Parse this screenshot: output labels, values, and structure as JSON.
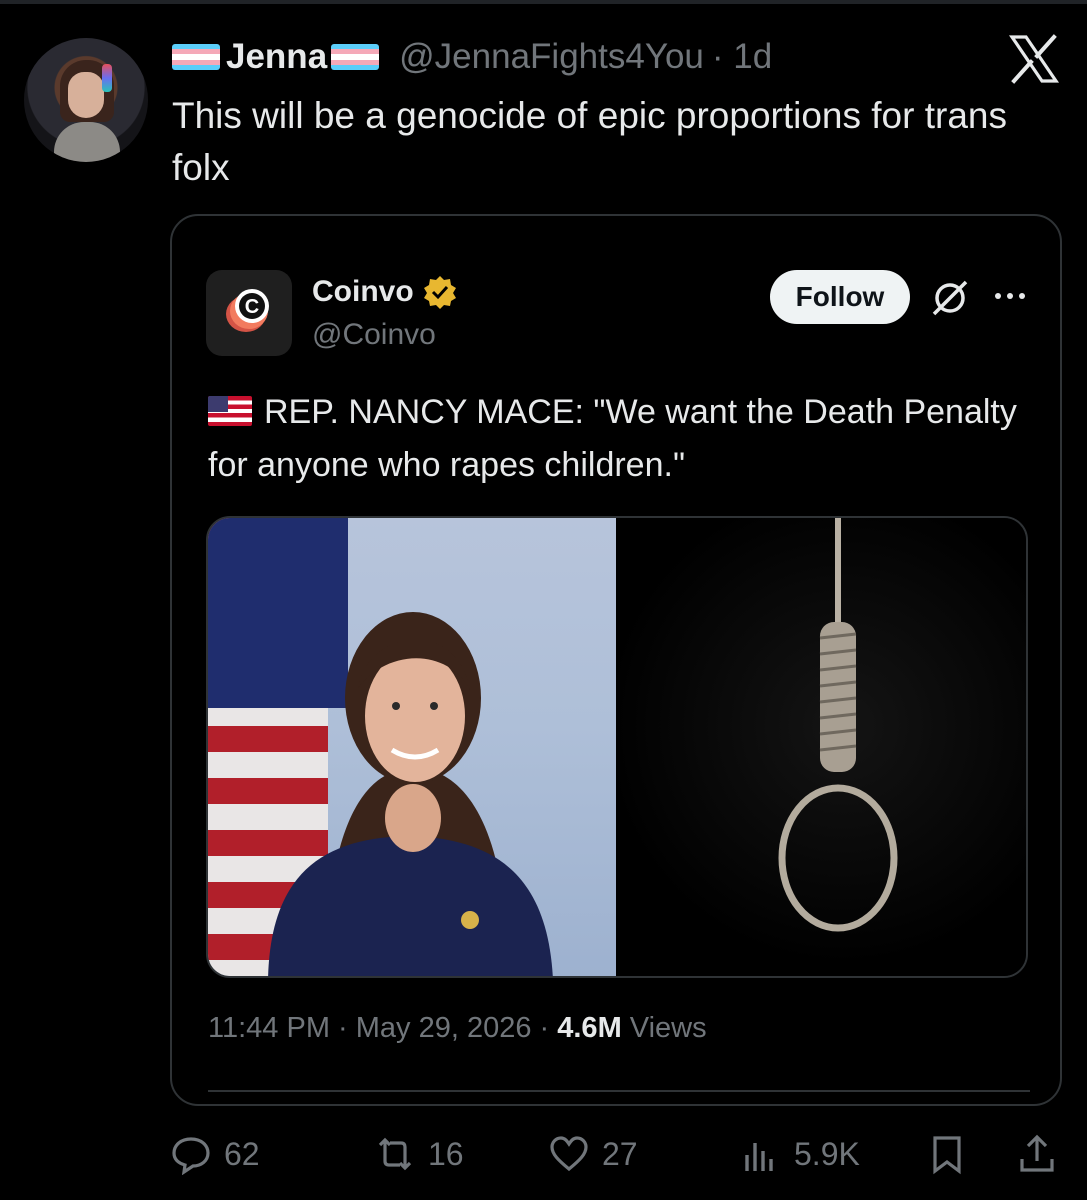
{
  "post": {
    "display_name": "Jenna",
    "handle": "@JennaFights4You",
    "time_ago": "· 1d",
    "text": "This will be a genocide of epic proportions for trans folx"
  },
  "quoted": {
    "name": "Coinvo",
    "handle": "@Coinvo",
    "follow_label": "Follow",
    "text": "REP. NANCY MACE: \"We want the Death Penalty for anyone who rapes children.\"",
    "time": "11:44 PM · May 29, 2026 · ",
    "views_count": "4.6M",
    "views_label": " Views"
  },
  "actions": {
    "replies": "62",
    "reposts": "16",
    "likes": "27",
    "views": "5.9K"
  },
  "icons": {
    "x_logo": "x-logo-icon",
    "verified": "verified-badge-icon",
    "grok": "grok-icon",
    "more": "more-icon",
    "reply": "reply-icon",
    "repost": "repost-icon",
    "like": "like-icon",
    "views": "views-icon",
    "bookmark": "bookmark-icon",
    "share": "share-icon"
  },
  "colors": {
    "background": "#000000",
    "text": "#e7e9ea",
    "secondary_text": "#71767b",
    "border": "#2f3336",
    "verified_gold": "#e8b730",
    "trans_blue": "#5bcefa",
    "trans_pink": "#f5a9b8"
  }
}
